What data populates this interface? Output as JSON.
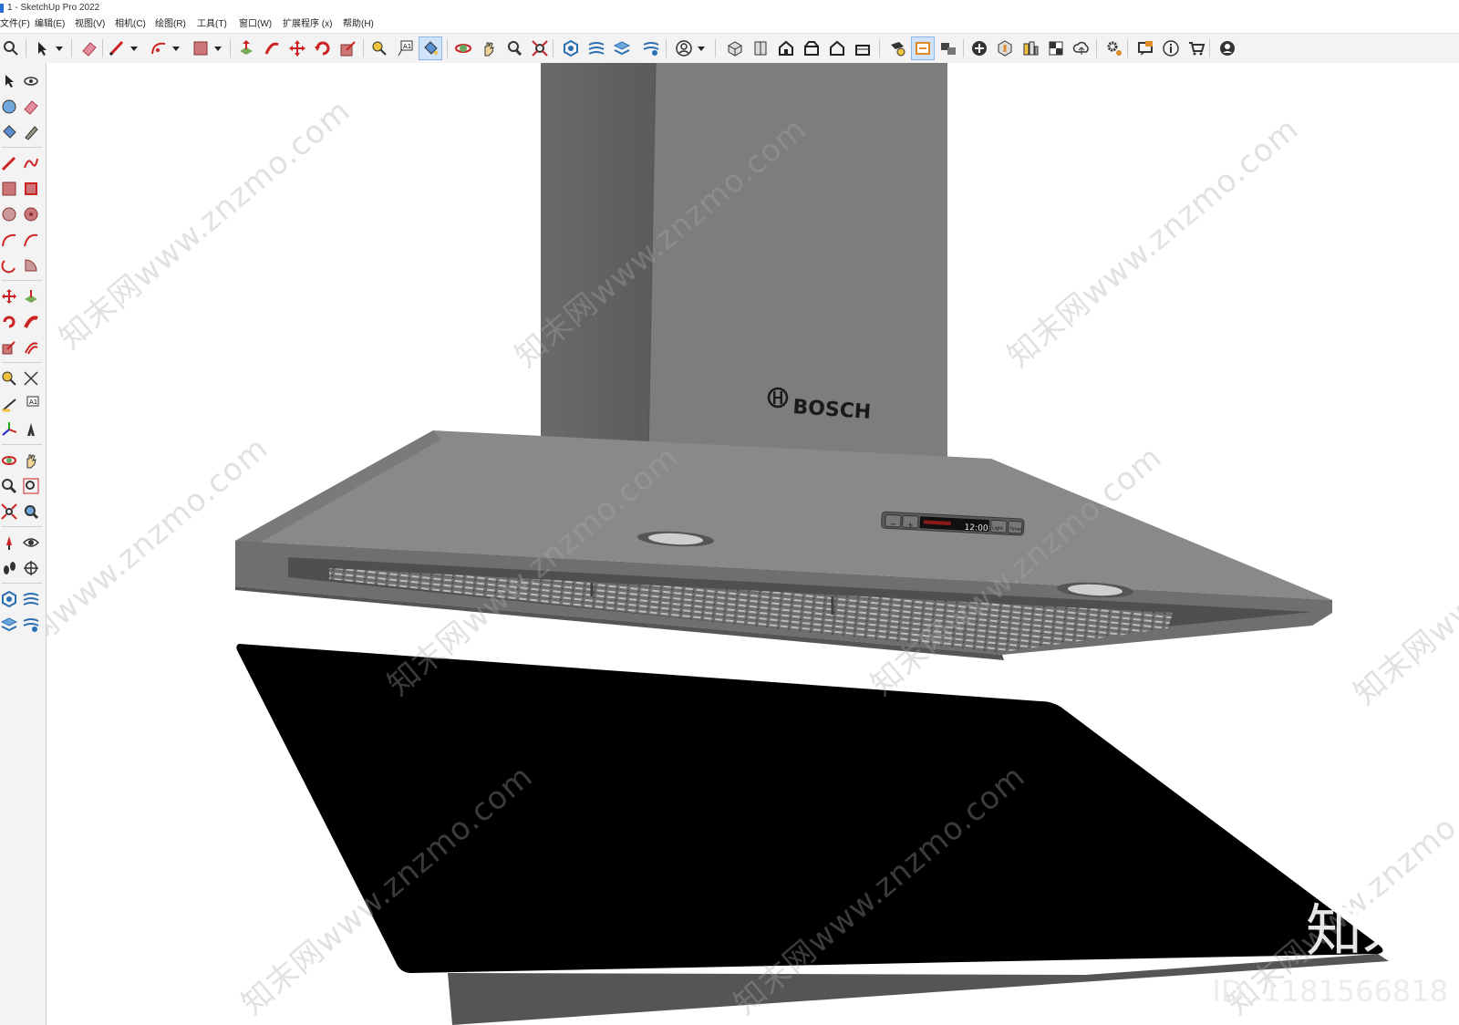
{
  "window": {
    "title": "1 - SketchUp Pro 2022"
  },
  "menu": {
    "items": [
      "文件(F)",
      "编辑(E)",
      "视图(V)",
      "相机(C)",
      "绘图(R)",
      "工具(T)",
      "窗口(W)",
      "扩展程序 (x)",
      "帮助(H)"
    ]
  },
  "model": {
    "brand": "BOSCH",
    "panel_minus": "−",
    "panel_plus": "+",
    "panel_time": "12:00",
    "panel_light": "Light",
    "panel_timer": "Timer"
  },
  "watermarks": {
    "site": "知末网www.znzmo.com",
    "brand": "知末",
    "id": "ID: 1181566818"
  },
  "colors": {
    "hood_dark": "#5f5f5f",
    "hood_mid": "#7d7d7d",
    "hood_light": "#8a8a8a",
    "cooktop": "#000000",
    "selected_tool": "#cfe3fa"
  },
  "toolbar_icons": [
    "search-icon",
    "select-arrow-icon",
    "eraser-icon",
    "pencil-line-icon",
    "arc-icon",
    "rectangle-icon",
    "push-pull-icon",
    "follow-me-icon",
    "move-icon",
    "rotate-icon",
    "scale-icon",
    "tape-measure-icon",
    "text-icon",
    "paint-bucket-icon",
    "orbit-icon",
    "pan-icon",
    "zoom-icon",
    "zoom-extents-icon",
    "warehouse-icon",
    "sandbox-icon",
    "layers-icon",
    "style-icon",
    "user-icon",
    "iso-view-icon",
    "top-view-icon",
    "front-view-icon",
    "right-view-icon",
    "back-view-icon",
    "left-view-icon",
    "section-plane-icon",
    "section-fill-icon",
    "scenes-icon",
    "add-location-icon",
    "shadow-icon",
    "fog-icon",
    "match-photo-icon",
    "cloud-icon",
    "settings-icon",
    "chat-icon",
    "info-icon",
    "cart-icon",
    "account-icon"
  ]
}
